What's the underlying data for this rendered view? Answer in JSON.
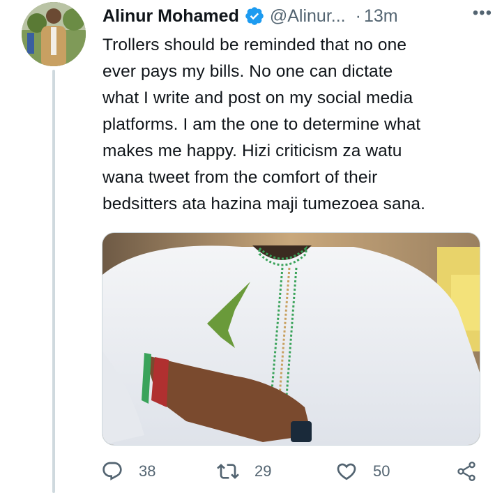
{
  "tweet": {
    "author_name": "Alinur Mohamed",
    "handle": "@Alinur...",
    "separator": "·",
    "timestamp": "13m",
    "more_label": "•••",
    "text": "Trollers should be reminded that no one\never pays my bills. No one can  dictate\nwhat I write and post on my social media\nplatforms. I am the one to determine what\nmakes me happy. Hizi criticism za watu\nwana tweet from the comfort of their\nbedsitters ata hazina maji tumezoea sana.",
    "verified_color": "#1d9bf0",
    "media_alt": ""
  },
  "actions": {
    "reply_icon": "reply-icon",
    "reply_count": "38",
    "retweet_icon": "retweet-icon",
    "retweet_count": "29",
    "like_icon": "like-icon",
    "like_count": "50",
    "share_icon": "share-icon"
  },
  "colors": {
    "text_primary": "#0f1419",
    "text_secondary": "#536471",
    "border": "#cfd9de"
  }
}
